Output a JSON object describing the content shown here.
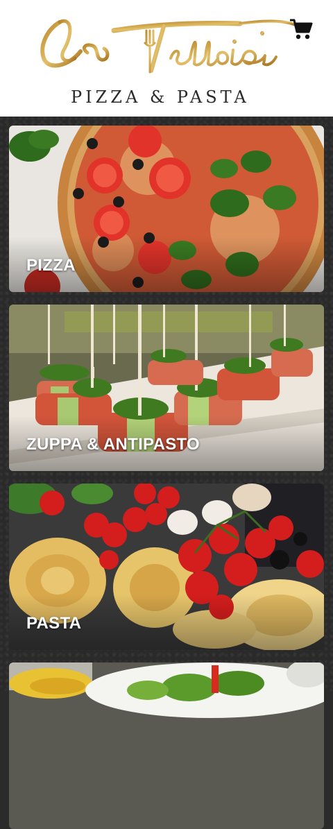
{
  "brand": {
    "name": "La Tettoia",
    "subtitle": "PIZZA & PASTA",
    "gold": "#c89a2e"
  },
  "header": {
    "cart_icon": "shopping-cart-icon"
  },
  "categories": [
    {
      "label": "PIZZA"
    },
    {
      "label": "ZUPPA & ANTIPASTO"
    },
    {
      "label": "PASTA"
    },
    {
      "label": ""
    }
  ]
}
